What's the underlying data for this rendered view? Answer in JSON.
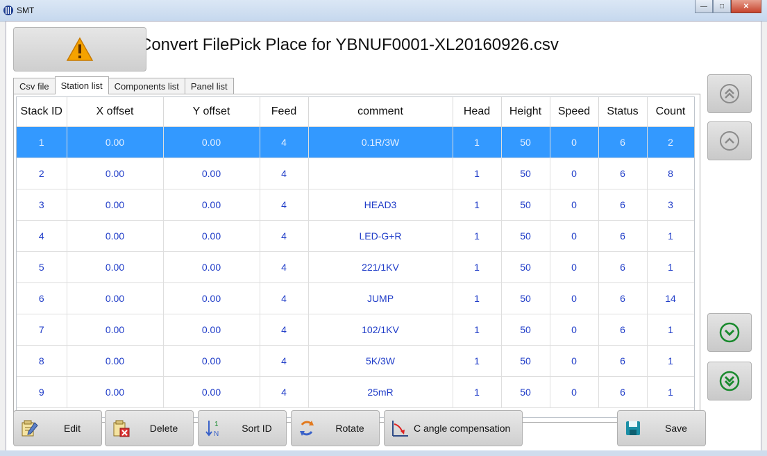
{
  "window": {
    "title": "SMT",
    "minimize_icon": "minimize-icon",
    "maximize_icon": "maximize-icon",
    "close_icon": "close-icon"
  },
  "header": {
    "warning_icon": "warning-icon",
    "title": "Convert FilePick Place for YBNUF0001-XL20160926.csv"
  },
  "tabs": [
    {
      "label": "Csv file",
      "active": false
    },
    {
      "label": "Station list",
      "active": true
    },
    {
      "label": "Components list",
      "active": false
    },
    {
      "label": "Panel list",
      "active": false
    }
  ],
  "table": {
    "columns": [
      "Stack ID",
      "X offset",
      "Y offset",
      "Feed",
      "comment",
      "Head",
      "Height",
      "Speed",
      "Status",
      "Count"
    ],
    "selected_row": 0,
    "rows": [
      [
        "1",
        "0.00",
        "0.00",
        "4",
        "0.1R/3W",
        "1",
        "50",
        "0",
        "6",
        "2"
      ],
      [
        "2",
        "0.00",
        "0.00",
        "4",
        "",
        "1",
        "50",
        "0",
        "6",
        "8"
      ],
      [
        "3",
        "0.00",
        "0.00",
        "4",
        "HEAD3",
        "1",
        "50",
        "0",
        "6",
        "3"
      ],
      [
        "4",
        "0.00",
        "0.00",
        "4",
        "LED-G+R",
        "1",
        "50",
        "0",
        "6",
        "1"
      ],
      [
        "5",
        "0.00",
        "0.00",
        "4",
        "221/1KV",
        "1",
        "50",
        "0",
        "6",
        "1"
      ],
      [
        "6",
        "0.00",
        "0.00",
        "4",
        "JUMP",
        "1",
        "50",
        "0",
        "6",
        "14"
      ],
      [
        "7",
        "0.00",
        "0.00",
        "4",
        "102/1KV",
        "1",
        "50",
        "0",
        "6",
        "1"
      ],
      [
        "8",
        "0.00",
        "0.00",
        "4",
        "5K/3W",
        "1",
        "50",
        "0",
        "6",
        "1"
      ],
      [
        "9",
        "0.00",
        "0.00",
        "4",
        "25mR",
        "1",
        "50",
        "0",
        "6",
        "1"
      ]
    ]
  },
  "nav": {
    "first_icon": "double-chevron-up-icon",
    "prev_icon": "chevron-up-icon",
    "next_icon": "chevron-down-icon",
    "last_icon": "double-chevron-down-icon"
  },
  "toolbar": {
    "edit_label": "Edit",
    "delete_label": "Delete",
    "sort_label": "Sort ID",
    "rotate_label": "Rotate",
    "angle_label": "C angle compensation",
    "save_label": "Save"
  },
  "colors": {
    "selection": "#3399ff",
    "cell_text": "#1f3cc8",
    "nav_green": "#1a8a2e"
  }
}
